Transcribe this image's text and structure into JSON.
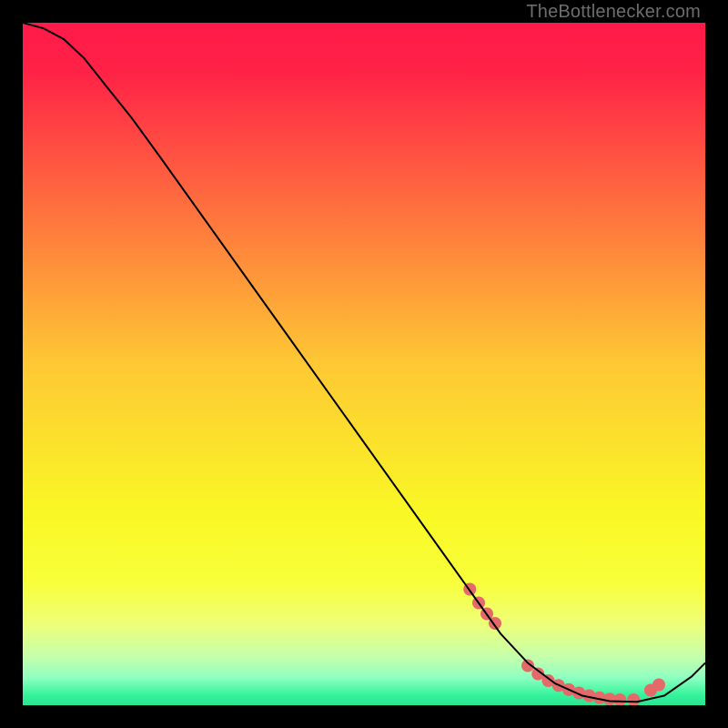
{
  "watermark": "TheBottlenecker.com",
  "chart_data": {
    "type": "line",
    "title": "",
    "xlabel": "",
    "ylabel": "",
    "xlim": [
      0,
      100
    ],
    "ylim": [
      0,
      100
    ],
    "grid": false,
    "background_gradient": {
      "stops": [
        {
          "offset": 0.0,
          "color": "#ff1a49"
        },
        {
          "offset": 0.07,
          "color": "#ff2247"
        },
        {
          "offset": 0.5,
          "color": "#fec834"
        },
        {
          "offset": 0.72,
          "color": "#f9f825"
        },
        {
          "offset": 0.82,
          "color": "#f8ff3a"
        },
        {
          "offset": 0.88,
          "color": "#eeff77"
        },
        {
          "offset": 0.93,
          "color": "#c4ffac"
        },
        {
          "offset": 0.96,
          "color": "#8dffc1"
        },
        {
          "offset": 0.985,
          "color": "#35f39a"
        },
        {
          "offset": 1.0,
          "color": "#2ae391"
        }
      ]
    },
    "series": [
      {
        "name": "curve",
        "stroke": "#000000",
        "stroke_width": 2,
        "x": [
          0,
          3,
          6,
          9,
          12,
          16,
          20,
          30,
          40,
          50,
          60,
          66,
          70,
          74,
          78,
          82,
          86,
          90,
          94,
          98,
          100
        ],
        "y": [
          100,
          99.2,
          97.6,
          94.8,
          91.0,
          86.0,
          80.5,
          66.5,
          52.5,
          38.5,
          24.5,
          16.1,
          10.5,
          6.2,
          3.2,
          1.4,
          0.6,
          0.5,
          1.4,
          4.2,
          6.2
        ]
      }
    ],
    "markers": {
      "name": "highlight-dots",
      "color": "#e46a6a",
      "radius": 7,
      "x": [
        65.5,
        66.8,
        68.0,
        69.2,
        74,
        75.5,
        77,
        78.5,
        80,
        81.5,
        83,
        84.5,
        86,
        87.5,
        89.5,
        92.0,
        93.2
      ],
      "y": [
        17.0,
        15.0,
        13.4,
        12.0,
        5.8,
        4.6,
        3.6,
        2.9,
        2.3,
        1.8,
        1.4,
        1.1,
        0.9,
        0.8,
        0.8,
        2.2,
        3.0
      ]
    }
  }
}
